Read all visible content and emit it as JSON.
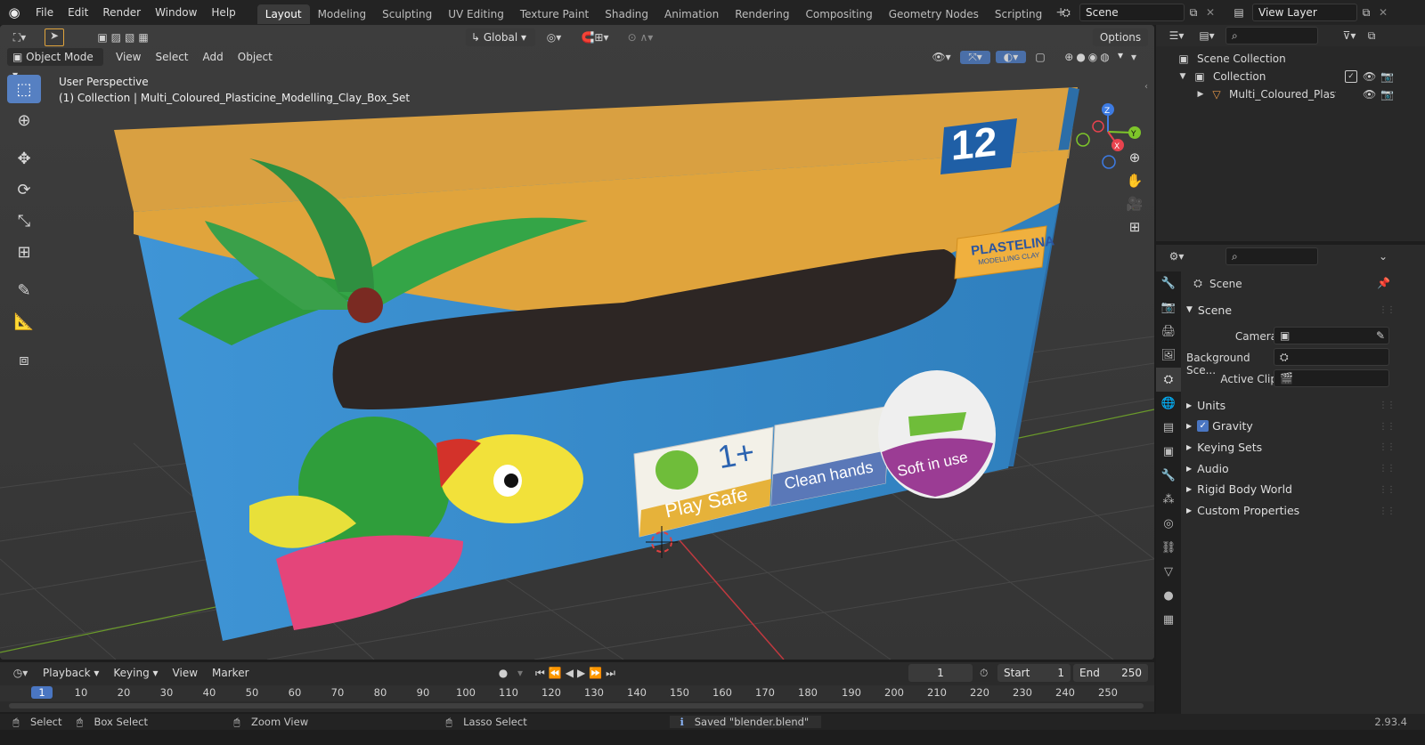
{
  "topbar": {
    "menus": [
      "File",
      "Edit",
      "Render",
      "Window",
      "Help"
    ],
    "workspaces": [
      "Layout",
      "Modeling",
      "Sculpting",
      "UV Editing",
      "Texture Paint",
      "Shading",
      "Animation",
      "Rendering",
      "Compositing",
      "Geometry Nodes",
      "Scripting"
    ],
    "active_workspace": "Layout",
    "scene_name": "Scene",
    "view_layer": "View Layer"
  },
  "viewport": {
    "mode": "Object Mode",
    "menus": [
      "View",
      "Select",
      "Add",
      "Object"
    ],
    "orientation": "Global",
    "options_label": "Options",
    "overlay_title": "User Perspective",
    "overlay_subtitle": "(1) Collection | Multi_Coloured_Plasticine_Modelling_Clay_Box_Set",
    "box_texts": {
      "count": "12",
      "brand": "PLASTELINA",
      "brand_sub": "MODELLING CLAY",
      "age": "1+",
      "play_safe": "Play Safe",
      "clean_hands": "Clean hands",
      "soft": "Soft in use"
    }
  },
  "gizmo": {
    "z": "Z",
    "y": "Y",
    "x": "X"
  },
  "outliner": {
    "root": "Scene Collection",
    "collection": "Collection",
    "object": "Multi_Coloured_Plasticine"
  },
  "properties": {
    "context": "Scene",
    "panel_title": "Scene",
    "camera_label": "Camera",
    "bg_scene_label": "Background Sce...",
    "active_clip_label": "Active Clip",
    "subpanels": [
      "Units",
      "Gravity",
      "Keying Sets",
      "Audio",
      "Rigid Body World",
      "Custom Properties"
    ],
    "gravity_checked": true
  },
  "timeline": {
    "menus": [
      "Playback",
      "Keying",
      "View",
      "Marker"
    ],
    "current_frame": "1",
    "start_label": "Start",
    "start": "1",
    "end_label": "End",
    "end": "250",
    "ruler": [
      "1",
      "10",
      "20",
      "30",
      "40",
      "50",
      "60",
      "70",
      "80",
      "90",
      "100",
      "110",
      "120",
      "130",
      "140",
      "150",
      "160",
      "170",
      "180",
      "190",
      "200",
      "210",
      "220",
      "230",
      "240",
      "250"
    ]
  },
  "statusbar": {
    "select": "Select",
    "box_select": "Box Select",
    "zoom_view": "Zoom View",
    "lasso_select": "Lasso Select",
    "message": "Saved \"blender.blend\"",
    "version": "2.93.4"
  },
  "colors": {
    "accent": "#5680c2",
    "box_orange": "#e0a43c",
    "box_blue": "#3b8fcf",
    "x_axis": "#e8434e",
    "y_axis": "#7ec62a",
    "z_axis": "#3d7be3"
  }
}
